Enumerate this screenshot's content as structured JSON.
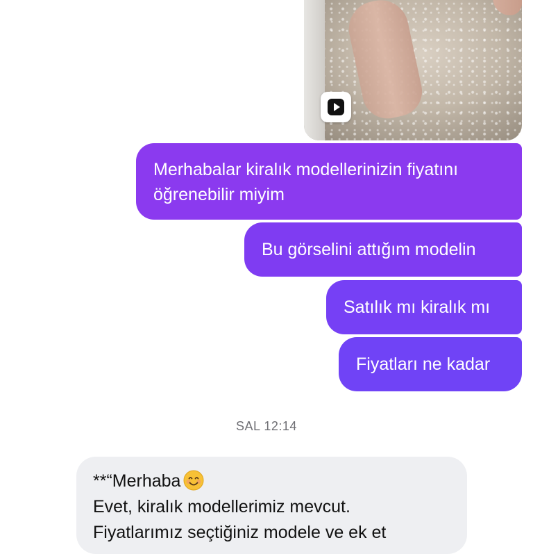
{
  "messages_outgoing": [
    {
      "text": "Merhabalar kiralık modellerinizin fiyatını öğrenebilir miyim"
    },
    {
      "text": "Bu görselini attığım modelin"
    },
    {
      "text": "Satılık mı kiralık mı"
    },
    {
      "text": "Fiyatları ne kadar"
    }
  ],
  "timestamp": "SAL 12:14",
  "incoming": {
    "line1": "**“Merhaba",
    "line1_emoji": "smiling-face-emoji",
    "line2": "Evet, kiralık modellerimiz mevcut.",
    "line3": "Fiyatlarımız seçtiğiniz modele ve ek et"
  },
  "media": {
    "play_icon": "play-icon"
  },
  "colors": {
    "outgoing_bubble": "#7c3bf6",
    "incoming_bubble": "#eeeff2",
    "timestamp_text": "#6e6e73"
  }
}
